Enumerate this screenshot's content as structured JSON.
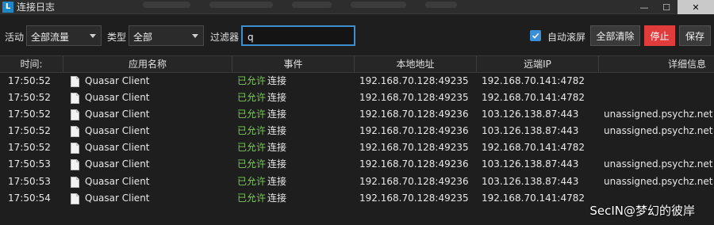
{
  "window": {
    "title": "连接日志",
    "icon_letter": "L"
  },
  "toolbar": {
    "activity_label": "活动",
    "activity_value": "全部流量",
    "type_label": "类型",
    "type_value": "全部",
    "filter_label": "过滤器",
    "filter_value": "q",
    "autoscroll_label": "自动滚屏",
    "autoscroll_checked": true,
    "clear_all_label": "全部清除",
    "stop_label": "停止",
    "save_label": "保存"
  },
  "table": {
    "columns": [
      "时间:",
      "应用名称",
      "事件",
      "本地地址",
      "远端IP",
      "详细信息"
    ],
    "rows": [
      {
        "time": "17:50:52",
        "app": "Quasar Client",
        "status": "已允许",
        "event": "连接",
        "local": "192.168.70.128:49235",
        "remote": "192.168.70.141:4782",
        "detail": ""
      },
      {
        "time": "17:50:52",
        "app": "Quasar Client",
        "status": "已允许",
        "event": "连接",
        "local": "192.168.70.128:49235",
        "remote": "192.168.70.141:4782",
        "detail": ""
      },
      {
        "time": "17:50:52",
        "app": "Quasar Client",
        "status": "已允许",
        "event": "连接",
        "local": "192.168.70.128:49236",
        "remote": "103.126.138.87:443",
        "detail": "unassigned.psychz.net"
      },
      {
        "time": "17:50:52",
        "app": "Quasar Client",
        "status": "已允许",
        "event": "连接",
        "local": "192.168.70.128:49236",
        "remote": "103.126.138.87:443",
        "detail": "unassigned.psychz.net"
      },
      {
        "time": "17:50:52",
        "app": "Quasar Client",
        "status": "已允许",
        "event": "连接",
        "local": "192.168.70.128:49235",
        "remote": "192.168.70.141:4782",
        "detail": ""
      },
      {
        "time": "17:50:53",
        "app": "Quasar Client",
        "status": "已允许",
        "event": "连接",
        "local": "192.168.70.128:49236",
        "remote": "103.126.138.87:443",
        "detail": "unassigned.psychz.net"
      },
      {
        "time": "17:50:53",
        "app": "Quasar Client",
        "status": "已允许",
        "event": "连接",
        "local": "192.168.70.128:49236",
        "remote": "103.126.138.87:443",
        "detail": "unassigned.psychz.net"
      },
      {
        "time": "17:50:54",
        "app": "Quasar Client",
        "status": "已允许",
        "event": "连接",
        "local": "192.168.70.128:49235",
        "remote": "192.168.70.141:4782",
        "detail": ""
      }
    ]
  },
  "watermark": "SecIN@梦幻的彼岸",
  "icons": {
    "app_row": "document-icon",
    "checkbox": "checkmark-icon"
  },
  "colors": {
    "accent": "#3e8fd0",
    "allowed": "#7cc95a",
    "stop": "#e03c3c"
  }
}
